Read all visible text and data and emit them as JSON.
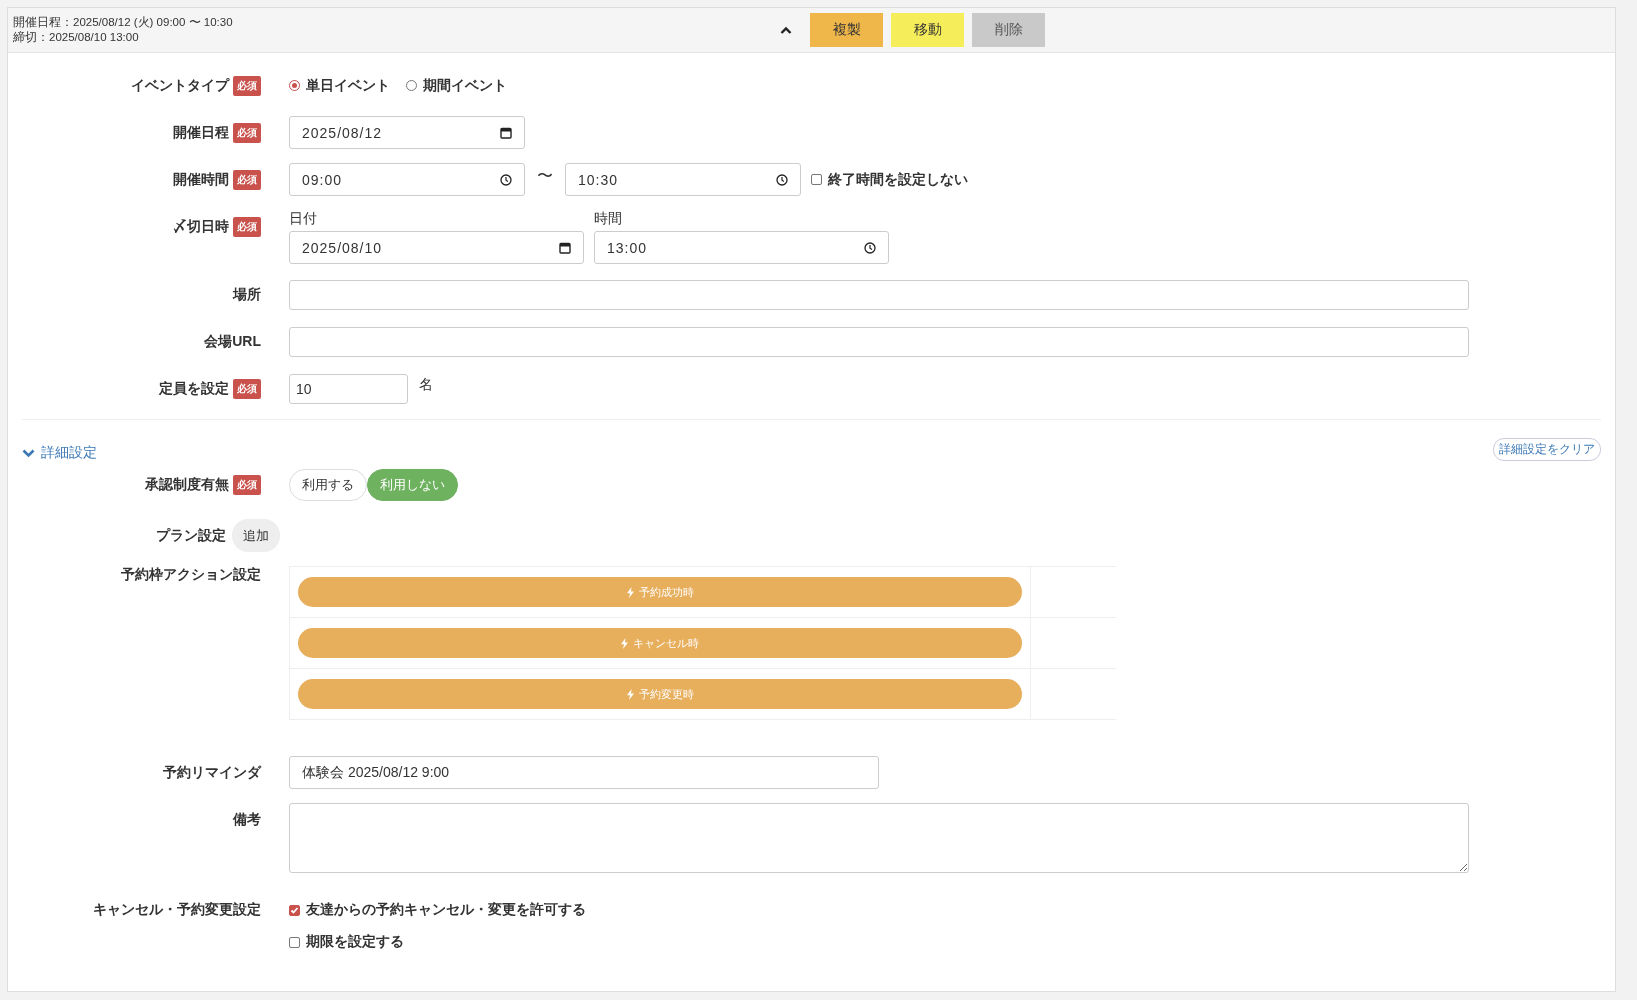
{
  "header": {
    "summary_lines": [
      "開催日程：2025/08/12 (火) 09:00 〜 10:30",
      "締切：2025/08/10 13:00"
    ],
    "buttons": [
      {
        "label": "複製",
        "kind": "copy"
      },
      {
        "label": "移動",
        "kind": "move"
      },
      {
        "label": "削除",
        "kind": "delete"
      }
    ]
  },
  "event_type": {
    "label": "イベントタイプ",
    "badge": "必須",
    "options": [
      {
        "label": "単日イベント",
        "selected": true
      },
      {
        "label": "期間イベント",
        "selected": false
      }
    ]
  },
  "event_date": {
    "label": "開催日程",
    "badge": "必須",
    "value": "2025/08/12"
  },
  "event_time": {
    "label": "開催時間",
    "badge": "必須",
    "start": "09:00",
    "separator": "〜",
    "end": "10:30",
    "no_end": {
      "label": "終了時間を設定しない",
      "checked": false
    }
  },
  "deadline": {
    "label": "〆切日時",
    "badge": "必須",
    "date_label": "日付",
    "date_value": "2025/08/10",
    "time_label": "時間",
    "time_value": "13:00"
  },
  "place": {
    "label": "場所"
  },
  "venue_url": {
    "label": "会場URL"
  },
  "capacity": {
    "label": "定員を設定",
    "badge": "必須",
    "value": "10",
    "unit": "名"
  },
  "details": {
    "toggle_label": "詳細設定",
    "expanded": true,
    "clear_button": "詳細設定をクリア"
  },
  "approval": {
    "label": "承認制度有無",
    "badge": "必須",
    "options": [
      {
        "label": "利用する",
        "selected": false
      },
      {
        "label": "利用しない",
        "selected": true
      }
    ]
  },
  "plan": {
    "label": "プラン設定",
    "add_button": "追加"
  },
  "actions": {
    "label": "予約枠アクション設定",
    "items": [
      {
        "label": "予約成功時"
      },
      {
        "label": "キャンセル時"
      },
      {
        "label": "予約変更時"
      }
    ]
  },
  "reminder": {
    "label": "予約リマインダ",
    "value": "体験会 2025/08/12 9:00"
  },
  "notes": {
    "label": "備考"
  },
  "cancel": {
    "label": "キャンセル・予約変更設定",
    "options": [
      {
        "label": "友達からの予約キャンセル・変更を許可する",
        "checked": true
      },
      {
        "label": "期限を設定する",
        "checked": false
      }
    ]
  }
}
